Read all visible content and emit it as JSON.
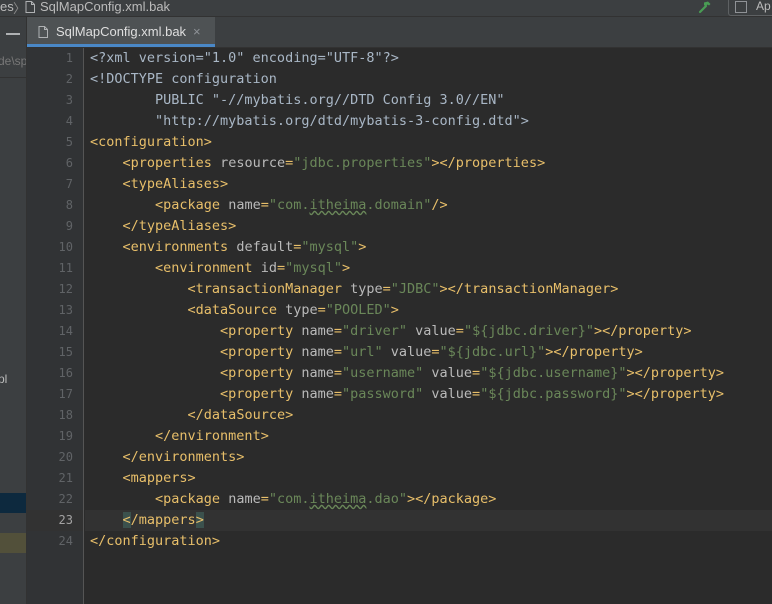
{
  "breadcrumb": {
    "prefix": "es",
    "separator": "〉",
    "file": "SqlMapConfig.xml.bak"
  },
  "run_config": {
    "label": "Ap"
  },
  "project_panel": {
    "path_fragment": "de\\sp",
    "mark": "pl"
  },
  "tab": {
    "label": "SqlMapConfig.xml.bak",
    "close": "×"
  },
  "editor": {
    "current_line": 23,
    "lines": [
      [
        [
          "p",
          "<?xml version=\"1.0\" encoding=\"UTF-8\"?>"
        ]
      ],
      [
        [
          "p",
          "<!DOCTYPE configuration"
        ]
      ],
      [
        [
          "p",
          "        PUBLIC \"-//mybatis.org//DTD Config 3.0//EN\""
        ]
      ],
      [
        [
          "p",
          "        \"http://mybatis.org/dtd/mybatis-3-config.dtd\">"
        ]
      ],
      [
        [
          "t",
          "<configuration>"
        ]
      ],
      [
        [
          "p",
          "    "
        ],
        [
          "t",
          "<properties "
        ],
        [
          "a",
          "resource"
        ],
        [
          "t",
          "="
        ],
        [
          "v",
          "\"jdbc.properties\""
        ],
        [
          "t",
          "></properties>"
        ]
      ],
      [
        [
          "p",
          "    "
        ],
        [
          "t",
          "<typeAliases>"
        ]
      ],
      [
        [
          "p",
          "        "
        ],
        [
          "t",
          "<package "
        ],
        [
          "a",
          "name"
        ],
        [
          "t",
          "="
        ],
        [
          "v",
          "\"com."
        ],
        [
          "squig",
          "itheima"
        ],
        [
          "v",
          ".domain\""
        ],
        [
          "t",
          "/>"
        ]
      ],
      [
        [
          "p",
          "    "
        ],
        [
          "t",
          "</typeAliases>"
        ]
      ],
      [
        [
          "p",
          "    "
        ],
        [
          "t",
          "<environments "
        ],
        [
          "a",
          "default"
        ],
        [
          "t",
          "="
        ],
        [
          "v",
          "\"mysql\""
        ],
        [
          "t",
          ">"
        ]
      ],
      [
        [
          "p",
          "        "
        ],
        [
          "t",
          "<environment "
        ],
        [
          "a",
          "id"
        ],
        [
          "t",
          "="
        ],
        [
          "v",
          "\"mysql\""
        ],
        [
          "t",
          ">"
        ]
      ],
      [
        [
          "p",
          "            "
        ],
        [
          "t",
          "<transactionManager "
        ],
        [
          "a",
          "type"
        ],
        [
          "t",
          "="
        ],
        [
          "v",
          "\"JDBC\""
        ],
        [
          "t",
          "></transactionManager>"
        ]
      ],
      [
        [
          "p",
          "            "
        ],
        [
          "t",
          "<dataSource "
        ],
        [
          "a",
          "type"
        ],
        [
          "t",
          "="
        ],
        [
          "v",
          "\"POOLED\""
        ],
        [
          "t",
          ">"
        ]
      ],
      [
        [
          "p",
          "                "
        ],
        [
          "t",
          "<property "
        ],
        [
          "a",
          "name"
        ],
        [
          "t",
          "="
        ],
        [
          "v",
          "\"driver\""
        ],
        [
          "t",
          " "
        ],
        [
          "a",
          "value"
        ],
        [
          "t",
          "="
        ],
        [
          "v",
          "\"${jdbc.driver}\""
        ],
        [
          "t",
          "></property>"
        ]
      ],
      [
        [
          "p",
          "                "
        ],
        [
          "t",
          "<property "
        ],
        [
          "a",
          "name"
        ],
        [
          "t",
          "="
        ],
        [
          "v",
          "\"url\""
        ],
        [
          "t",
          " "
        ],
        [
          "a",
          "value"
        ],
        [
          "t",
          "="
        ],
        [
          "v",
          "\"${jdbc.url}\""
        ],
        [
          "t",
          "></property>"
        ]
      ],
      [
        [
          "p",
          "                "
        ],
        [
          "t",
          "<property "
        ],
        [
          "a",
          "name"
        ],
        [
          "t",
          "="
        ],
        [
          "v",
          "\"username\""
        ],
        [
          "t",
          " "
        ],
        [
          "a",
          "value"
        ],
        [
          "t",
          "="
        ],
        [
          "v",
          "\"${jdbc.username}\""
        ],
        [
          "t",
          "></property>"
        ]
      ],
      [
        [
          "p",
          "                "
        ],
        [
          "t",
          "<property "
        ],
        [
          "a",
          "name"
        ],
        [
          "t",
          "="
        ],
        [
          "v",
          "\"password\""
        ],
        [
          "t",
          " "
        ],
        [
          "a",
          "value"
        ],
        [
          "t",
          "="
        ],
        [
          "v",
          "\"${jdbc.password}\""
        ],
        [
          "t",
          "></property>"
        ]
      ],
      [
        [
          "p",
          "            "
        ],
        [
          "t",
          "</dataSource>"
        ]
      ],
      [
        [
          "p",
          "        "
        ],
        [
          "t",
          "</environment>"
        ]
      ],
      [
        [
          "p",
          "    "
        ],
        [
          "t",
          "</environments>"
        ]
      ],
      [
        [
          "p",
          "    "
        ],
        [
          "t",
          "<mappers>"
        ]
      ],
      [
        [
          "p",
          "        "
        ],
        [
          "t",
          "<package "
        ],
        [
          "a",
          "name"
        ],
        [
          "t",
          "="
        ],
        [
          "v",
          "\"com."
        ],
        [
          "squig",
          "itheima"
        ],
        [
          "v",
          ".dao\""
        ],
        [
          "t",
          "></package>"
        ]
      ],
      [
        [
          "p",
          "    "
        ],
        [
          "hl",
          "<"
        ],
        [
          "t",
          "/mappers"
        ],
        [
          "hl",
          ">"
        ]
      ],
      [
        [
          "t",
          "</configuration>"
        ]
      ]
    ]
  },
  "colors": {
    "background": "#2b2b2b",
    "gutter": "#313335",
    "tag": "#e8bf6a",
    "attribute": "#bababa",
    "string": "#6a8759",
    "plain": "#a9b7c6",
    "accent": "#4a88c7"
  }
}
